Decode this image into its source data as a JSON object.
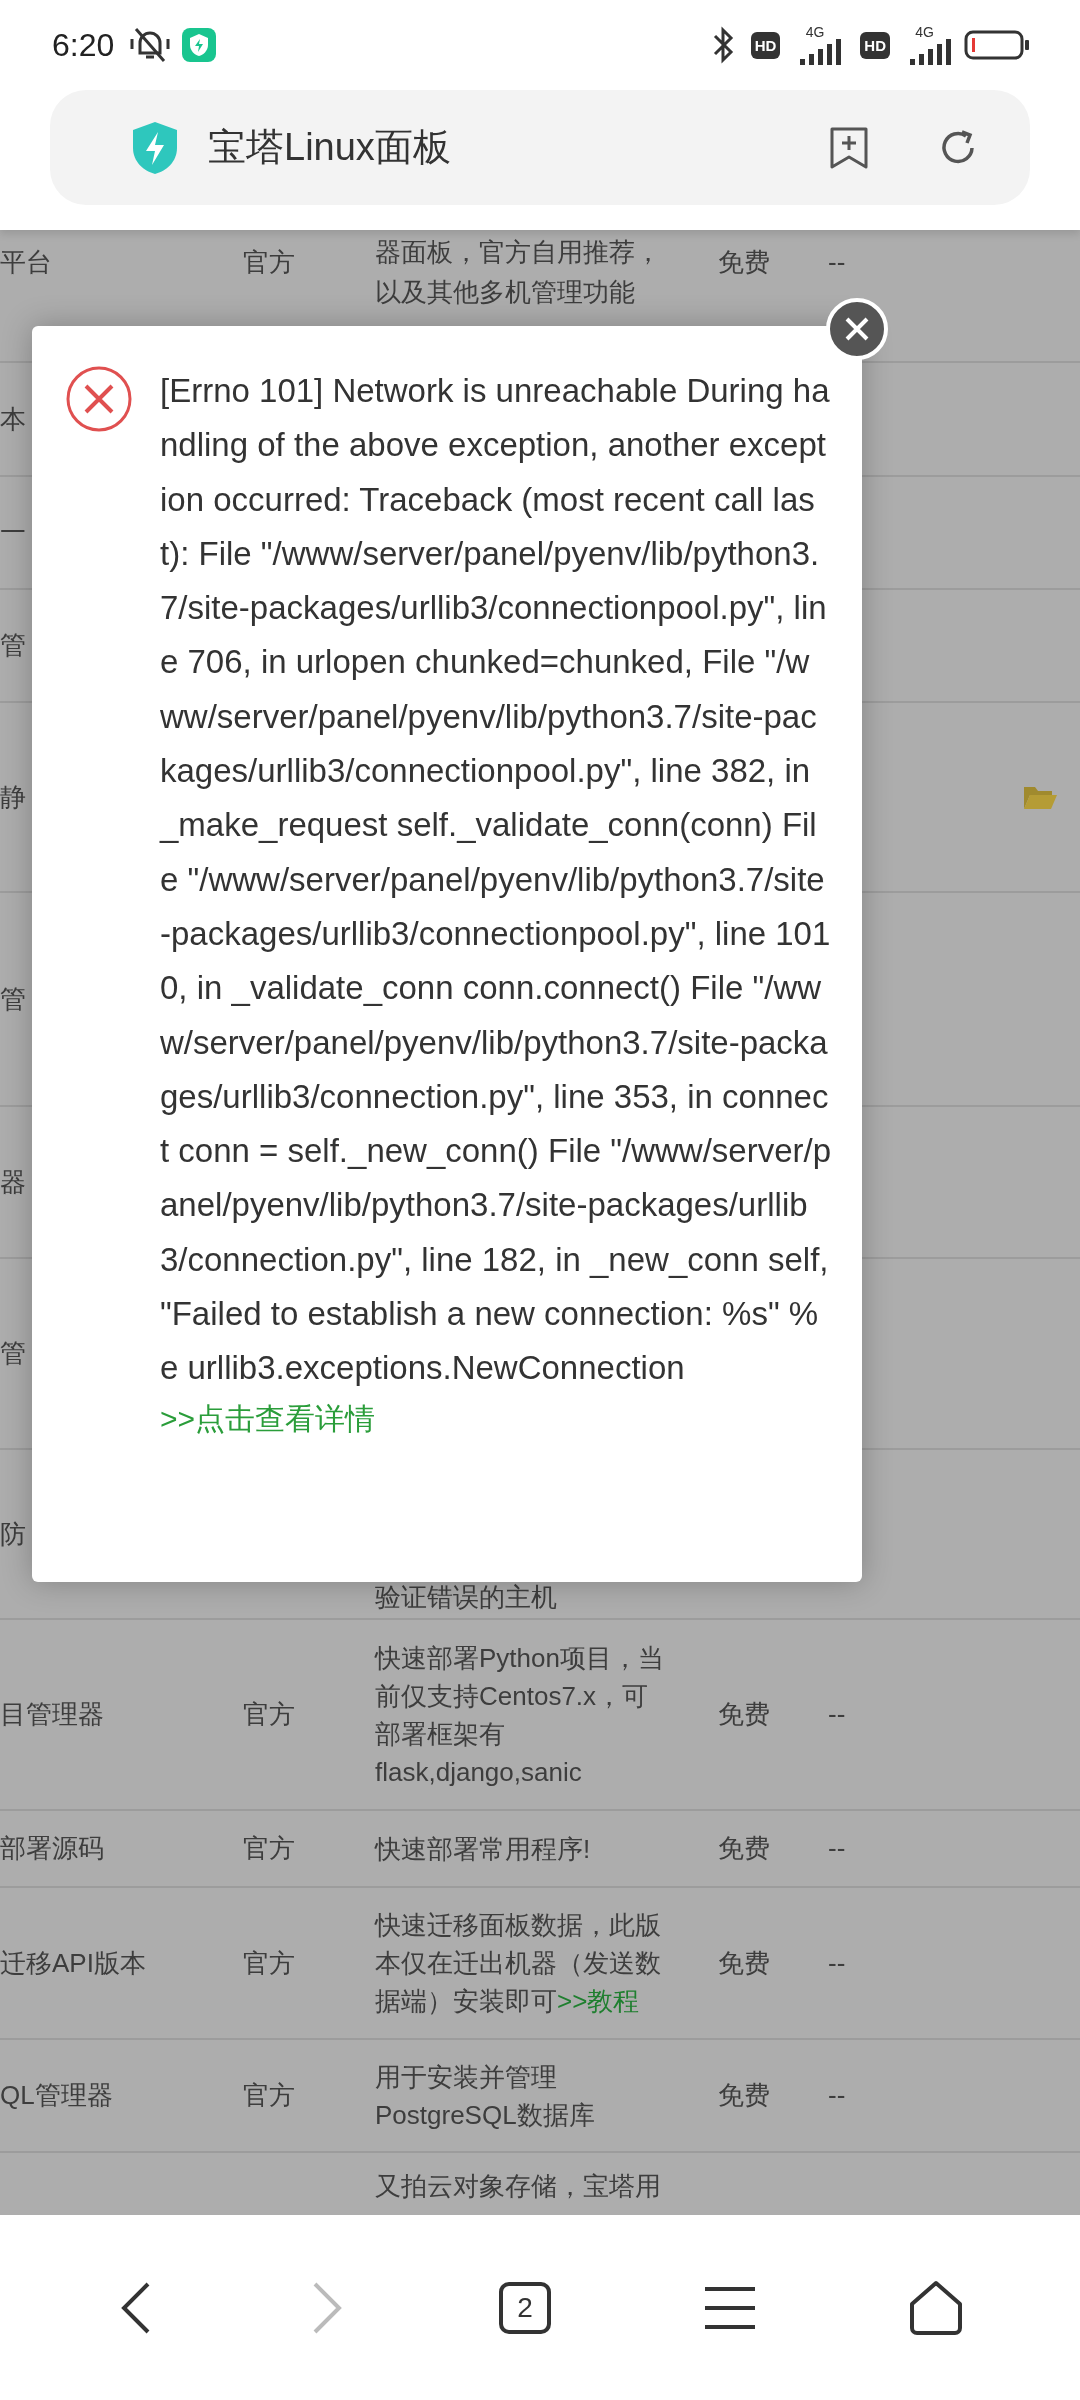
{
  "status_bar": {
    "time": "6:20",
    "sims": [
      {
        "badge": "HD",
        "network": "4G"
      },
      {
        "badge": "HD",
        "network": "4G"
      }
    ]
  },
  "address_bar": {
    "title": "宝塔Linux面板"
  },
  "table": {
    "rows": [
      {
        "name": "平台",
        "source": "官方",
        "description": "器面板，官方自用推荐，以及其他多机管理功能",
        "price": "免费",
        "action": "--"
      },
      {
        "name": "本"
      },
      {
        "name": "一"
      },
      {
        "name": "管"
      },
      {
        "name": "静",
        "folder": true
      },
      {
        "name": "管"
      },
      {
        "name": "器"
      },
      {
        "name": "管"
      },
      {
        "name": "防",
        "description": "验证错误的主机"
      },
      {
        "name": "目管理器",
        "source": "官方",
        "description": "快速部署Python项目，当前仅支持Centos7.x，可部署框架有 flask,django,sanic",
        "price": "免费",
        "action": "--"
      },
      {
        "name": "部署源码",
        "source": "官方",
        "description": "快速部署常用程序!",
        "price": "免费",
        "action": "--"
      },
      {
        "name": "迁移API版本",
        "source": "官方",
        "description": "快速迁移面板数据，此版本仅在迁出机器（发送数据端）安装即可",
        "link": ">>教程",
        "price": "免费",
        "action": "--"
      },
      {
        "name": "QL管理器",
        "source": "官方",
        "description": "用于安装并管理PostgreSQL数据库",
        "price": "免费",
        "action": "--"
      },
      {
        "description": "又拍云对象存储，宝塔用"
      }
    ]
  },
  "dialog": {
    "message": "[Errno 101] Network is unreachable During handling of the above exception, another exception occurred: Traceback (most recent call last): File \"/www/server/panel/pyenv/lib/python3.7/site-packages/urllib3/connectionpool.py\", line 706, in urlopen chunked=chunked, File \"/www/server/panel/pyenv/lib/python3.7/site-packages/urllib3/connectionpool.py\", line 382, in _make_request self._validate_conn(conn) File \"/www/server/panel/pyenv/lib/python3.7/site-packages/urllib3/connectionpool.py\", line 1010, in _validate_conn conn.connect() File \"/www/server/panel/pyenv/lib/python3.7/site-packages/urllib3/connection.py\", line 353, in connect conn = self._new_conn() File \"/www/server/panel/pyenv/lib/python3.7/site-packages/urllib3/connection.py\", line 182, in _new_conn self, \"Failed to establish a new connection: %s\" % e urllib3.exceptions.NewConnection",
    "link": ">>点击查看详情"
  },
  "bottom_nav": {
    "tab_count": "2",
    "forward_disabled": true
  }
}
